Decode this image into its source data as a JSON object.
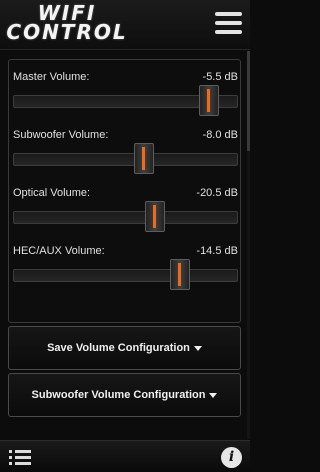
{
  "header": {
    "logo_line1": "WIFI",
    "logo_line2": "CONTROL",
    "menu_icon": "hamburger-menu-icon"
  },
  "volumes": [
    {
      "label": "Master Volume:",
      "value": "-5.5 dB",
      "position_fraction": 0.87
    },
    {
      "label": "Subwoofer Volume:",
      "value": "-8.0 dB",
      "position_fraction": 0.58
    },
    {
      "label": "Optical Volume:",
      "value": "-20.5 dB",
      "position_fraction": 0.63
    },
    {
      "label": "HEC/AUX Volume:",
      "value": "-14.5 dB",
      "position_fraction": 0.74
    }
  ],
  "buttons": {
    "save_config": "Save Volume Configuration",
    "subwoofer_config": "Subwoofer Volume Configuration"
  },
  "footer": {
    "list_icon": "list-icon",
    "info_icon": "info-icon",
    "info_glyph": "i"
  },
  "colors": {
    "accent": "#f06a1c",
    "background": "#0c0c0c"
  }
}
